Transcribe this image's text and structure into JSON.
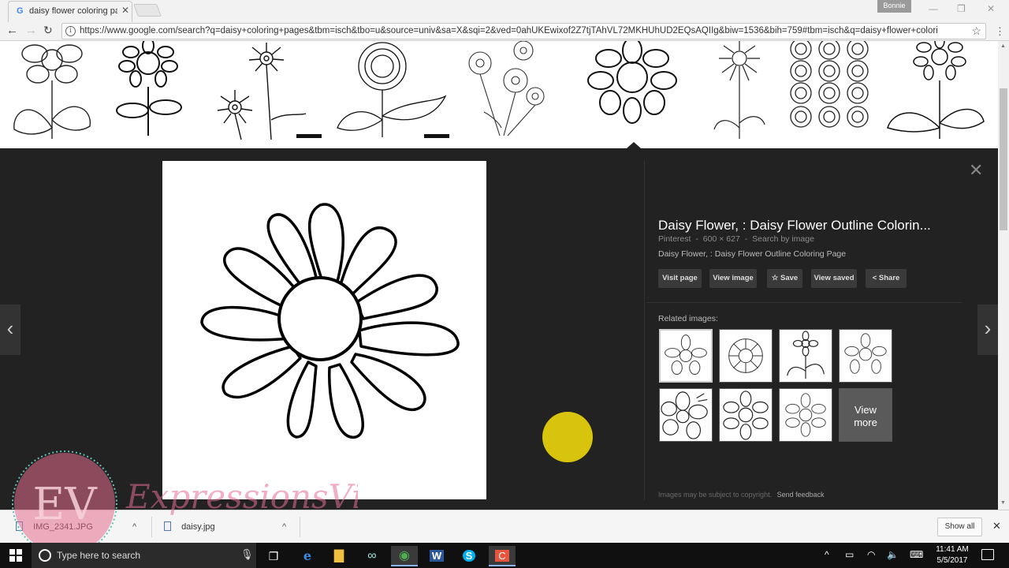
{
  "browser": {
    "tab_title": "daisy flower coloring pag",
    "tab_favicon": "google-g-icon",
    "profile_name": "Bonnie",
    "url": "https://www.google.com/search?q=daisy+coloring+pages&tbm=isch&tbo=u&source=univ&sa=X&sqi=2&ved=0ahUKEwixof2Z7tjTAhVL72MKHUhUD2EQsAQIIg&biw=1536&bih=759#tbm=isch&q=daisy+flower+colori"
  },
  "viewer": {
    "title": "Daisy Flower, : Daisy Flower Outline Colorin...",
    "source": "Pinterest",
    "dimensions": "600 × 627",
    "search_by_image": "Search by image",
    "separator": "-",
    "caption": "Daisy Flower, : Daisy Flower Outline Coloring Page",
    "actions": {
      "visit_page": "Visit page",
      "view_image": "View image",
      "save": "Save",
      "view_saved": "View saved",
      "share": "Share"
    },
    "related_label": "Related images:",
    "view_more": "View more",
    "copyright_note": "Images may be subject to copyright.",
    "send_feedback": "Send feedback"
  },
  "watermark": {
    "monogram": "EV",
    "brand": "ExpressionsVinyl"
  },
  "downloads": {
    "items": [
      {
        "name": "IMG_2341.JPG"
      },
      {
        "name": "daisy.jpg"
      }
    ],
    "show_all": "Show all"
  },
  "taskbar": {
    "search_placeholder": "Type here to search",
    "time": "11:41 AM",
    "date": "5/5/2017"
  },
  "icons": [
    "google-g-icon",
    "back-icon",
    "forward-icon",
    "reload-icon",
    "info-icon",
    "bookmark-star-icon",
    "menu-icon",
    "close-icon",
    "chevron-left-icon",
    "chevron-right-icon",
    "share-icon",
    "windows-start-icon",
    "cortana-icon",
    "microphone-icon",
    "task-view-icon",
    "edge-icon",
    "file-explorer-icon",
    "infinity-app-icon",
    "chrome-icon",
    "word-icon",
    "skype-icon",
    "screencast-icon",
    "battery-icon",
    "wifi-icon",
    "volume-icon",
    "keyboard-icon",
    "notification-icon"
  ],
  "colors": {
    "viewer_bg": "#222222",
    "cursor_highlight": "#e8d10c",
    "button_bg": "#3a3a3a"
  }
}
